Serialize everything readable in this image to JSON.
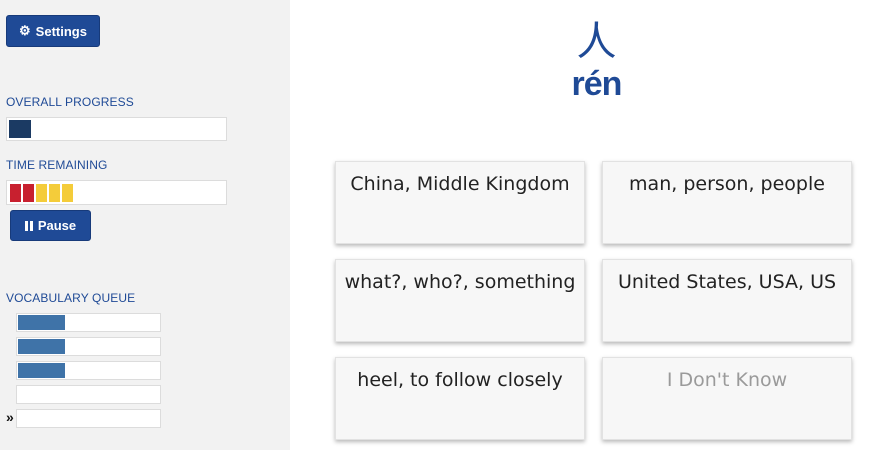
{
  "sidebar": {
    "settings_label": "Settings",
    "overall_progress": {
      "label": "OVERALL PROGRESS",
      "value": 0.1
    },
    "time_remaining": {
      "label": "TIME REMAINING",
      "segments": [
        {
          "color": "#c8202f"
        },
        {
          "color": "#c8202f"
        },
        {
          "color": "#f4cc3a"
        },
        {
          "color": "#f4cc3a"
        },
        {
          "color": "#f4cc3a"
        }
      ]
    },
    "pause_label": "Pause",
    "vocabulary_queue": {
      "label": "VOCABULARY QUEUE",
      "items": [
        {
          "fill": 0.33
        },
        {
          "fill": 0.33
        },
        {
          "fill": 0.33
        },
        {
          "fill": 0
        },
        {
          "fill": 0,
          "current": true
        }
      ],
      "marker": "»"
    }
  },
  "prompt": {
    "character": "人",
    "pinyin": "rén"
  },
  "choices": [
    {
      "label": "China, Middle Kingdom"
    },
    {
      "label": "man, person, people"
    },
    {
      "label": "what?, who?, something"
    },
    {
      "label": "United States, USA, US"
    },
    {
      "label": "heel, to follow closely"
    },
    {
      "label": "I Don't Know"
    }
  ],
  "colors": {
    "accent": "#1f4a96",
    "overall_fill": "#1b3a63",
    "queue_fill": "#3f73a8"
  }
}
